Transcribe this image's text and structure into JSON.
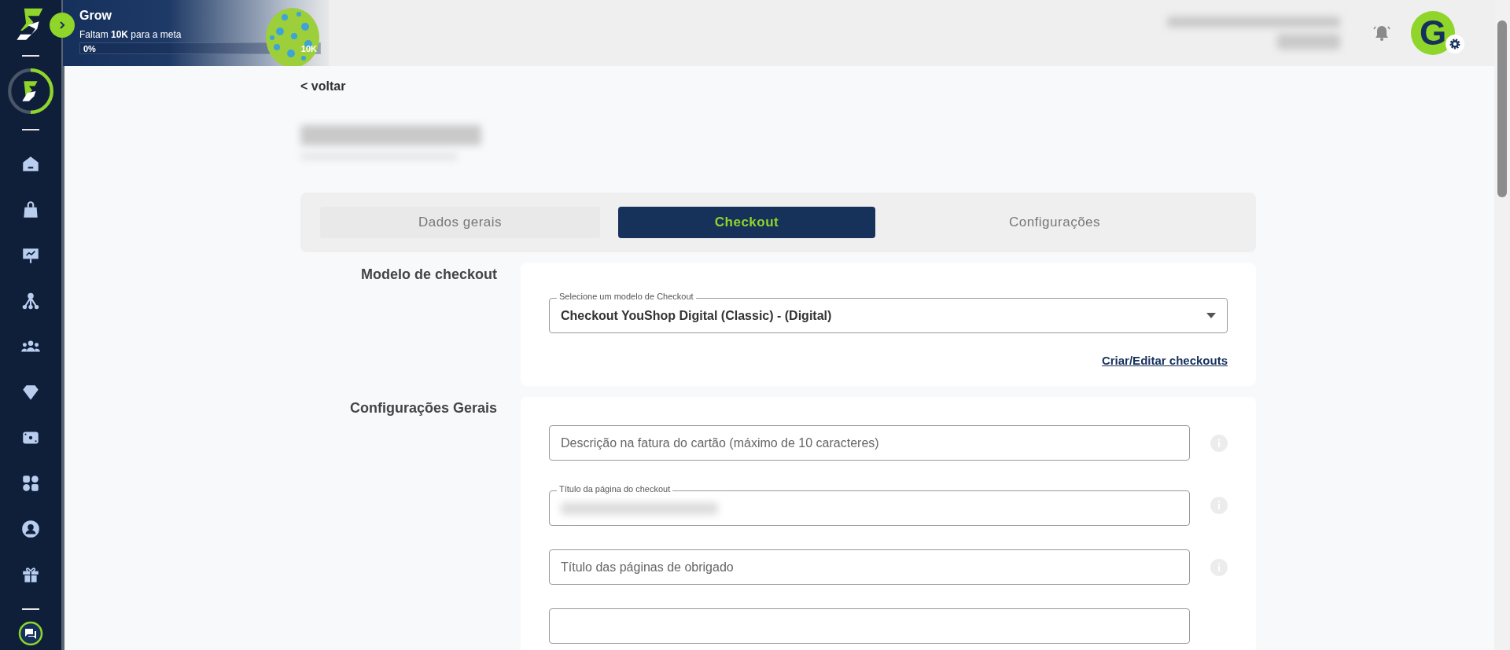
{
  "grow_banner": {
    "title": "Grow",
    "goal_text": "Faltam **10K** para a meta",
    "start_label": "0%",
    "end_label": "10K",
    "level": 0
  },
  "user": {
    "initial": "G"
  },
  "back_link": "< voltar",
  "tabs": [
    {
      "label": "Dados gerais",
      "selected": false
    },
    {
      "label": "Checkout",
      "selected": true
    },
    {
      "label": "Configurações",
      "selected": false
    }
  ],
  "sections": [
    {
      "title": "Modelo de checkout",
      "fields": [
        {
          "kind": "select",
          "label": "Selecione um modelo de Checkout",
          "value": "Checkout YouShop Digital (Classic) - (Digital)"
        },
        {
          "kind": "link",
          "text": "Criar/Editar checkouts"
        }
      ]
    },
    {
      "title": "Configurações Gerais",
      "fields": [
        {
          "kind": "input",
          "placeholder": "Descrição na fatura do cartão (máximo de 10 caracteres)",
          "info": true
        },
        {
          "kind": "blurred-input",
          "label": "Título da página do checkout",
          "info": true
        },
        {
          "kind": "input",
          "placeholder": "Título das páginas de obrigado",
          "info": true
        },
        {
          "kind": "input",
          "info": false
        }
      ]
    }
  ]
}
